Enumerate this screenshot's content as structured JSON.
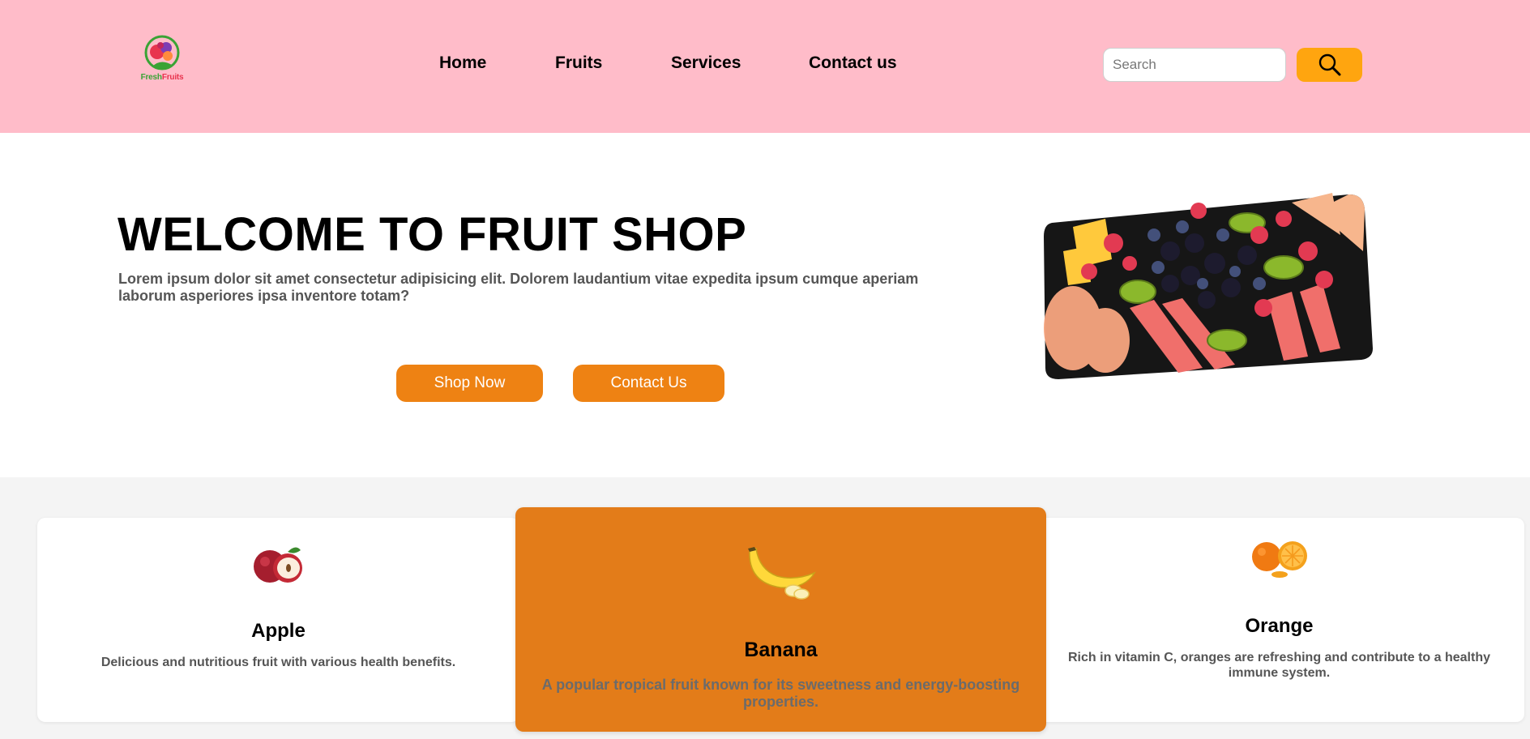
{
  "header": {
    "logo": {
      "text_fresh": "Fresh",
      "text_fruits": "Fruits",
      "icon": "fruit-basket-logo-icon"
    },
    "nav": [
      {
        "label": "Home"
      },
      {
        "label": "Fruits"
      },
      {
        "label": "Services"
      },
      {
        "label": "Contact us"
      }
    ],
    "search": {
      "placeholder": "Search",
      "value": "",
      "button_icon": "search-icon"
    },
    "colors": {
      "background": "#ffbcc9",
      "search_button": "#ffa50f"
    }
  },
  "hero": {
    "title": "WELCOME TO FRUIT SHOP",
    "text": "Lorem ipsum dolor sit amet consectetur adipisicing elit. Dolorem laudantium vitae expedita ipsum cumque aperiam laborum asperiores ipsa inventore totam?",
    "buttons": {
      "shop_label": "Shop Now",
      "contact_label": "Contact Us"
    },
    "image": "fruit-platter-image",
    "colors": {
      "button": "#ee8213"
    }
  },
  "cards": [
    {
      "title": "Apple",
      "description": "Delicious and nutritious fruit with various health benefits.",
      "icon": "apple-icon"
    },
    {
      "title": "Banana",
      "description": "A popular tropical fruit known for its sweetness and energy-boosting properties.",
      "icon": "banana-icon",
      "highlight_color": "#e37c19"
    },
    {
      "title": "Orange",
      "description": "Rich in vitamin C, oranges are refreshing and contribute to a healthy immune system.",
      "icon": "orange-icon"
    }
  ]
}
